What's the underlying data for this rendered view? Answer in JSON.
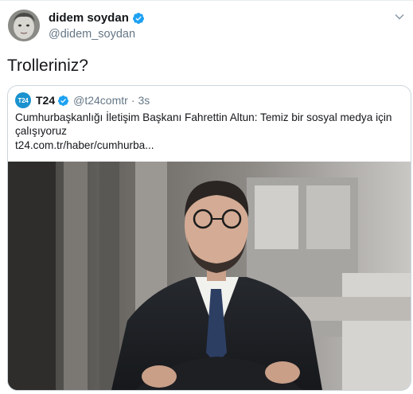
{
  "tweet": {
    "display_name": "didem soydan",
    "handle": "@didem_soydan",
    "text": "Trolleriniz?"
  },
  "quote": {
    "logo_text": "T24",
    "display_name": "T24",
    "handle": "@t24comtr",
    "separator": "·",
    "time": "3s",
    "text": "Cumhurbaşkanlığı İletişim Başkanı Fahrettin Altun: Temiz bir sosyal medya için çalışıyoruz",
    "link": "t24.com.tr/haber/cumhurba..."
  },
  "colors": {
    "verified": "#1da1f2",
    "secondary_text": "#657786",
    "border": "#ccd6dd",
    "t24_logo": "#1a92cf"
  },
  "icons": [
    "avatar",
    "verified-badge-icon",
    "chevron-down-icon",
    "t24-logo",
    "news-photo"
  ]
}
